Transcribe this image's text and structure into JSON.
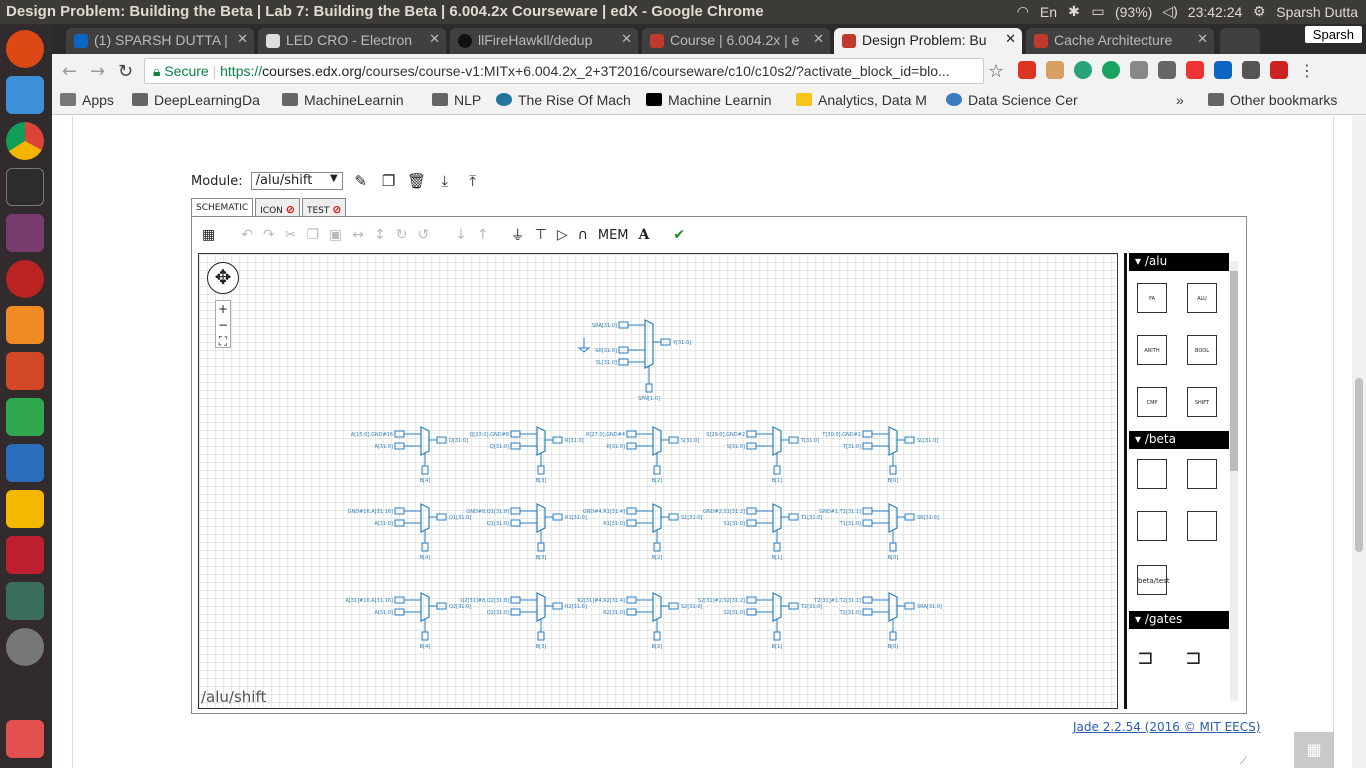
{
  "window": {
    "title": "Design Problem: Building the Beta | Lab 7: Building the Beta | 6.004.2x Courseware | edX - Google Chrome"
  },
  "tray": {
    "lang": "En",
    "battery": "(93%)",
    "time": "23:42:24",
    "user": "Sparsh Dutta"
  },
  "tabs": [
    {
      "label": "(1) SPARSH DUTTA |",
      "color": "#0a66c2"
    },
    {
      "label": "LED CRO - Electron",
      "color": "#ffffff"
    },
    {
      "label": "llFireHawkll/dedup",
      "color": "#222222"
    },
    {
      "label": "Course | 6.004.2x | e",
      "color": "#c0392b"
    },
    {
      "label": "Design Problem: Bu",
      "color": "#c0392b"
    },
    {
      "label": "Cache Architecture",
      "color": "#c0392b"
    }
  ],
  "profile": "Sparsh",
  "address": {
    "secure": "Secure",
    "scheme": "https://",
    "host": "courses.edx.org",
    "path": "/courses/course-v1:MITx+6.004.2x_2+3T2016/courseware/c10/c10s2/?activate_block_id=blo..."
  },
  "bookmarks": [
    {
      "label": "Apps",
      "color": "#666"
    },
    {
      "label": "DeepLearningDa",
      "color": "#666"
    },
    {
      "label": "MachineLearnin",
      "color": "#666"
    },
    {
      "label": "NLP",
      "color": "#666"
    },
    {
      "label": "The Rise Of Mach",
      "color": "#21759b"
    },
    {
      "label": "Machine Learnin",
      "color": "#000"
    },
    {
      "label": "Analytics, Data M",
      "color": "#f5c518"
    },
    {
      "label": "Data Science Cer",
      "color": "#3b7bbf"
    },
    {
      "label": "»",
      "color": "transparent"
    },
    {
      "label": "Other bookmarks",
      "color": "#666"
    }
  ],
  "module": {
    "label": "Module:",
    "value": "/alu/shift"
  },
  "editor_tabs": [
    "SCHEMATIC",
    "ICON",
    "TEST"
  ],
  "toolbar": {
    "mem": "MEM",
    "text": "A"
  },
  "canvas": {
    "label": "/alu/shift"
  },
  "parts": {
    "groups": [
      "/alu",
      "/beta",
      "/gates"
    ],
    "alu_parts": [
      "FA",
      "ALU",
      "ARITH",
      "BOOL",
      "CMP",
      "SHIFT"
    ],
    "beta_test": "beta/test"
  },
  "schematic": {
    "top_mux": {
      "inputs": [
        "SRA[31:0]",
        "SR[31:0]",
        "SL[31:0]"
      ],
      "output": "Y[31:0]",
      "select": "SFN[1:0]"
    },
    "rows": [
      {
        "mux_a": [
          "A[15:0],GND#16",
          "Q[23:0],GND#8",
          "R[27:0],GND#4",
          "S[29:0],GND#2",
          "T[30:0],GND#1"
        ],
        "mux_b": [
          "A[31:0]",
          "Q[31:0]",
          "R[31:0]",
          "S[31:0]",
          "T[31:0]"
        ],
        "out": [
          "Q[31:0]",
          "R[31:0]",
          "S[31:0]",
          "T[31:0]",
          "SL[31:0]"
        ],
        "sel": [
          "B[4]",
          "B[3]",
          "B[2]",
          "B[1]",
          "B[0]"
        ]
      },
      {
        "mux_a": [
          "GND#16,A[31:16]",
          "GND#8,Q1[31:8]",
          "GND#4,R1[31:4]",
          "GND#2,S1[31:2]",
          "GND#1,T1[31:1]"
        ],
        "mux_b": [
          "A[31:0]",
          "Q1[31:0]",
          "R1[31:0]",
          "S1[31:0]",
          "T1[31:0]"
        ],
        "out": [
          "Q1[31:0]",
          "R1[31:0]",
          "S1[31:0]",
          "T1[31:0]",
          "SR[31:0]"
        ],
        "sel": [
          "B[4]",
          "B[3]",
          "B[2]",
          "B[1]",
          "B[0]"
        ]
      },
      {
        "mux_a": [
          "A[31]#16,A[31:16]",
          "Q2[31]#8,Q2[31:8]",
          "R2[31]#4,R2[31:4]",
          "S2[31]#2,S2[31:2]",
          "T2[31]#1,T2[31:1]"
        ],
        "mux_b": [
          "A[31:0]",
          "Q2[31:0]",
          "R2[31:0]",
          "S2[31:0]",
          "T2[31:0]"
        ],
        "out": [
          "Q2[31:0]",
          "R2[31:0]",
          "S2[31:0]",
          "T2[31:0]",
          "SRA[31:0]"
        ],
        "sel": [
          "B[4]",
          "B[3]",
          "B[2]",
          "B[1]",
          "B[0]"
        ]
      }
    ]
  },
  "footer": {
    "jade": "Jade 2.2.54 (2016 © MIT EECS)"
  },
  "colors": {
    "wire": "#2a7fc0",
    "launcher": "#322b2e"
  }
}
